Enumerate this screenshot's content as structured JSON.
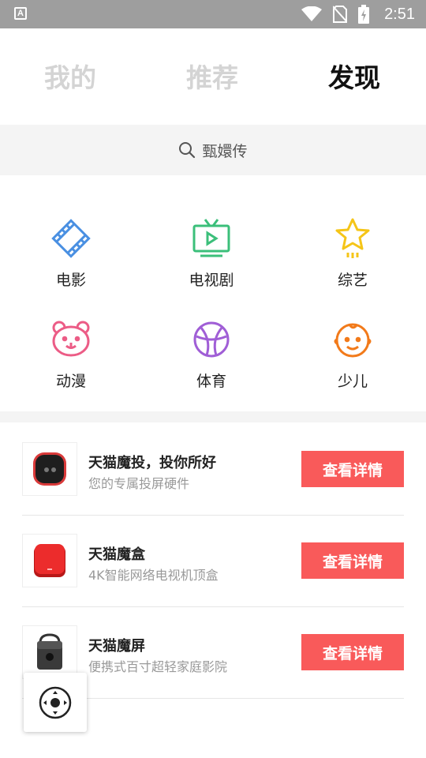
{
  "status_bar": {
    "time": "2:51",
    "app_letter": "A"
  },
  "tabs": [
    {
      "label": "我的",
      "active": false
    },
    {
      "label": "推荐",
      "active": false
    },
    {
      "label": "发现",
      "active": true
    }
  ],
  "search": {
    "text": "甄嬛传"
  },
  "categories": [
    {
      "label": "电影",
      "icon": "film-icon",
      "color": "#4a90e2"
    },
    {
      "label": "电视剧",
      "icon": "tv-icon",
      "color": "#3bbf7a"
    },
    {
      "label": "综艺",
      "icon": "star-icon",
      "color": "#f5c518"
    },
    {
      "label": "动漫",
      "icon": "bear-icon",
      "color": "#ec5c86"
    },
    {
      "label": "体育",
      "icon": "ball-icon",
      "color": "#a05ed6"
    },
    {
      "label": "少儿",
      "icon": "child-icon",
      "color": "#f27a1a"
    }
  ],
  "products": [
    {
      "title": "天猫魔投，投你所好",
      "subtitle": "您的专属投屏硬件",
      "button": "查看详情",
      "icon": "projector-icon"
    },
    {
      "title": "天猫魔盒",
      "subtitle": "4K智能网络电视机顶盒",
      "button": "查看详情",
      "icon": "box-icon"
    },
    {
      "title": "天猫魔屏",
      "subtitle": "便携式百寸超轻家庭影院",
      "button": "查看详情",
      "icon": "screen-projector-icon"
    }
  ],
  "colors": {
    "accent": "#f95a5a",
    "status_bar": "#9e9e9e"
  },
  "floating_button": {
    "icon": "remote-control-icon"
  }
}
